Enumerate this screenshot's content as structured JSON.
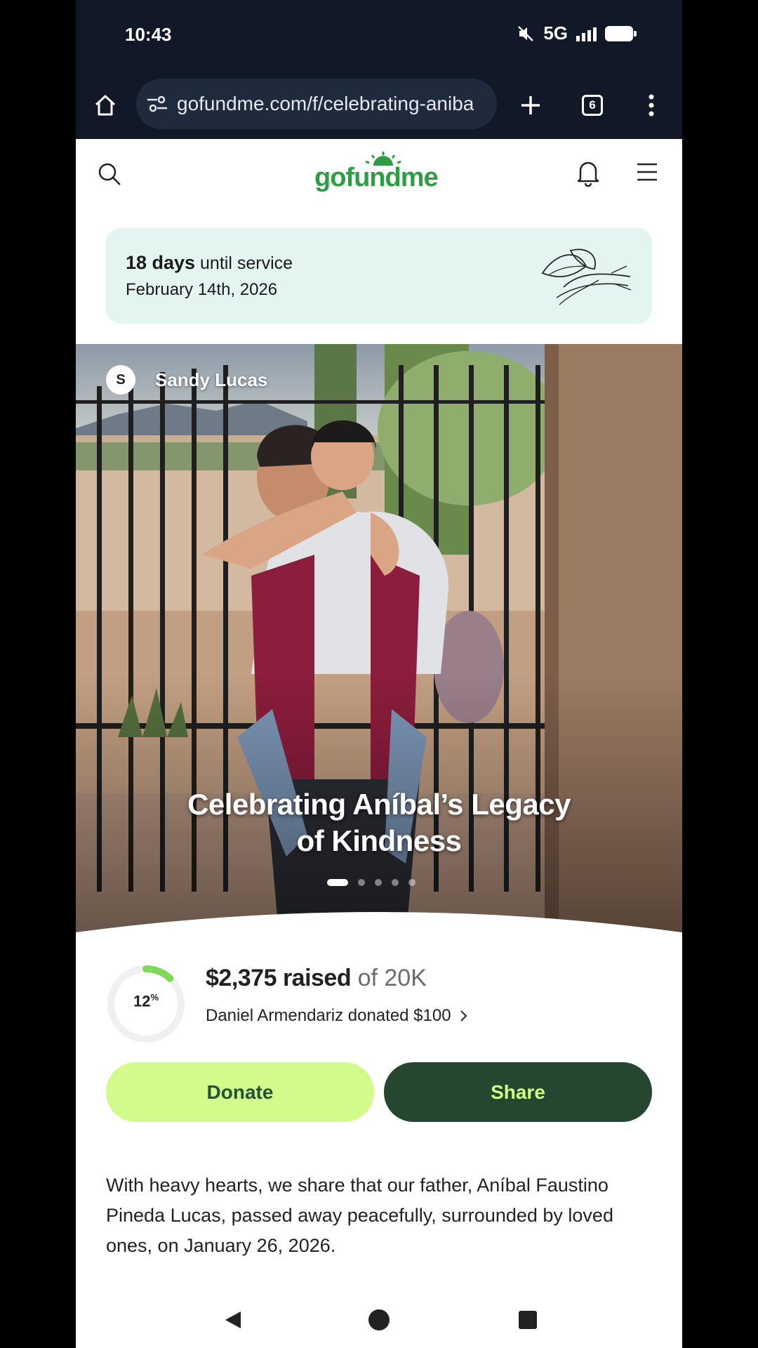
{
  "status_bar": {
    "time": "10:43",
    "network": "5G"
  },
  "browser": {
    "url": "gofundme.com/f/celebrating-aniba",
    "tab_count": "6"
  },
  "site": {
    "logo_text": "gofundme"
  },
  "service": {
    "days": "18 days",
    "until": "until service",
    "date": "February 14th, 2026"
  },
  "campaign": {
    "organizer_initial": "S",
    "organizer_name": "Sandy Lucas",
    "title_line1": "Celebrating Aníbal’s Legacy",
    "title_line2": "of Kindness",
    "slides": 5,
    "active_slide": 1
  },
  "progress": {
    "percent_value": "12",
    "percent_sign": "%",
    "fraction": 0.12,
    "raised": "$2,375 raised",
    "goal": "of 20K",
    "recent_donation": "Daniel Armendariz donated $100"
  },
  "actions": {
    "donate": "Donate",
    "share": "Share"
  },
  "story": {
    "text": "With heavy hearts, we share that our father, Aníbal Faustino Pineda Lucas, passed away peacefully, surrounded by loved ones, on January 26, 2026."
  },
  "colors": {
    "brand_green": "#2e9e44",
    "donate_bg": "#d2fb8c",
    "share_bg": "#26472f",
    "service_bg": "#e4f5f1",
    "progress_green": "#7ed957"
  },
  "icons": [
    "home-icon",
    "site-settings-icon",
    "new-tab-icon",
    "more-icon",
    "search-icon",
    "bell-icon",
    "menu-icon",
    "chevron-right-icon",
    "mute-icon",
    "back-icon",
    "home-nav-icon",
    "recents-icon"
  ]
}
